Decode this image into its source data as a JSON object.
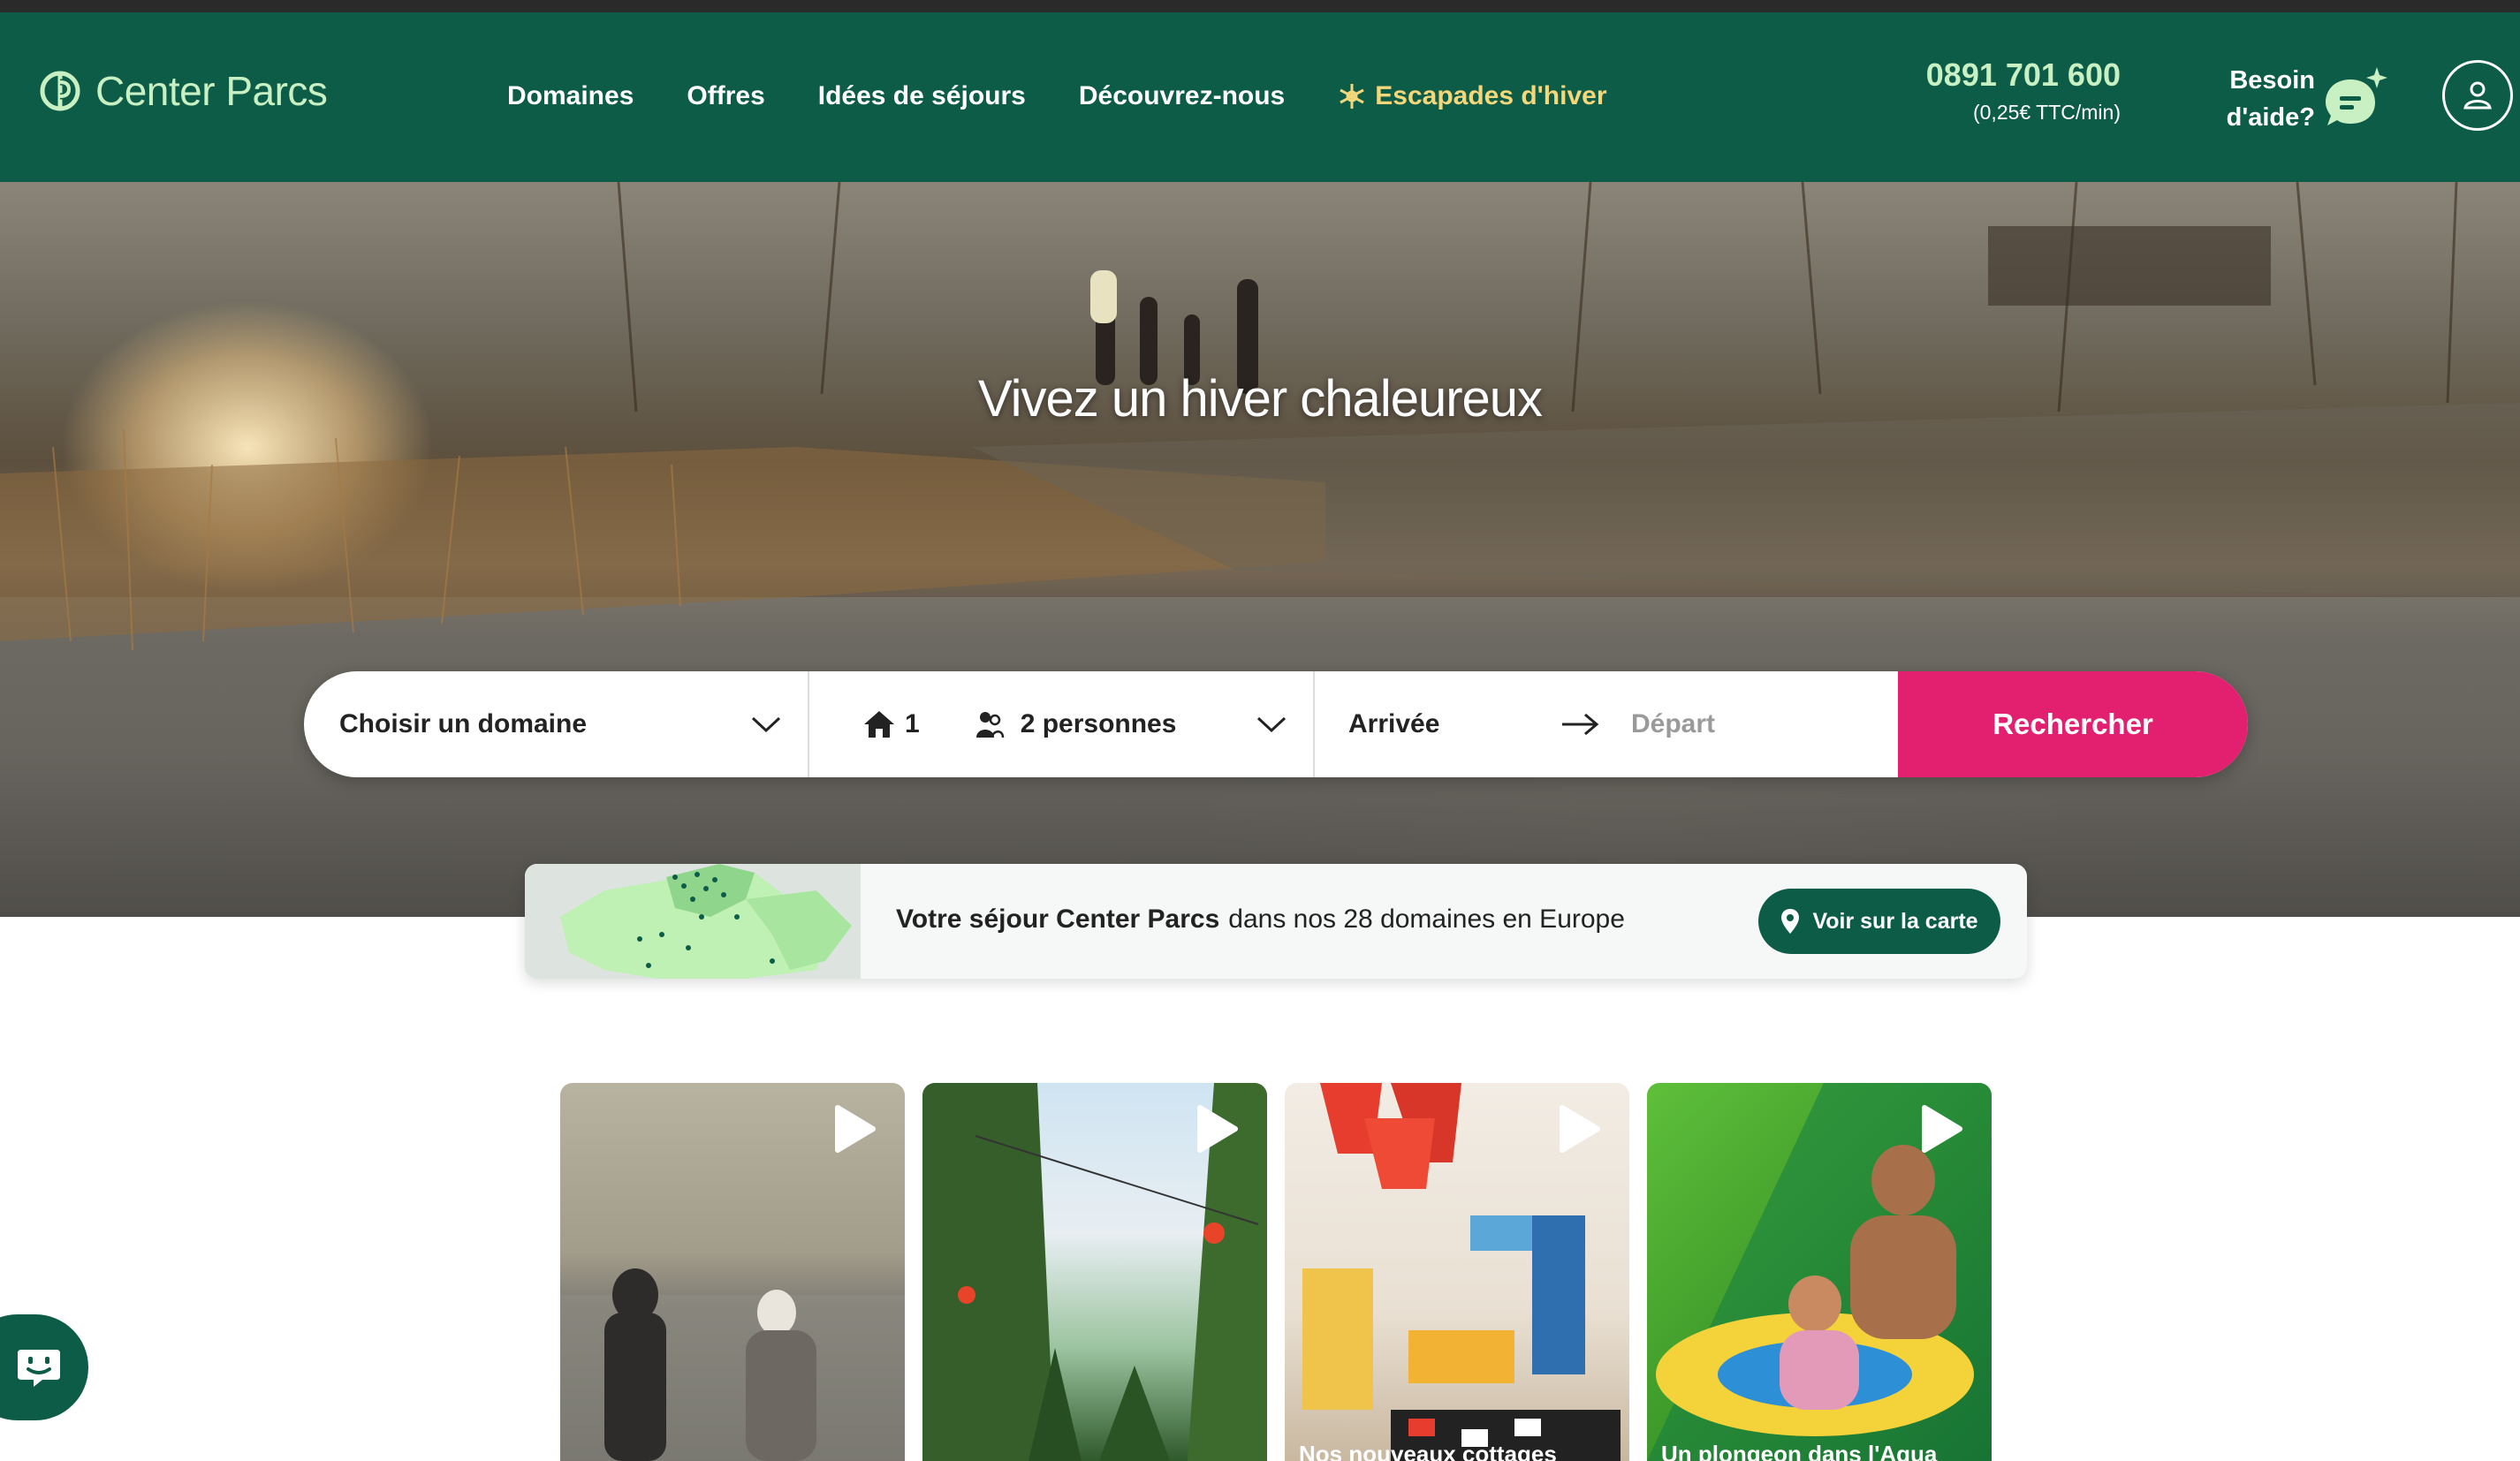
{
  "header": {
    "logo_text": "Center Parcs",
    "nav": {
      "domaines": "Domaines",
      "offres": "Offres",
      "idees": "Idées de séjours",
      "decouvrez": "Découvrez-nous",
      "escapades": "Escapades d'hiver"
    },
    "phone_number": "0891 701 600",
    "phone_rate": "(0,25€ TTC/min)",
    "help_line1": "Besoin",
    "help_line2": "d'aide?"
  },
  "hero": {
    "title": "Vivez un hiver chaleureux"
  },
  "search": {
    "domain_label": "Choisir un domaine",
    "houses_count": "1",
    "people_label": "2 personnes",
    "arrival_label": "Arrivée",
    "departure_placeholder": "Départ",
    "submit_label": "Rechercher"
  },
  "map_card": {
    "bold_text": "Votre séjour Center Parcs",
    "text": "dans nos 28 domaines en Europe",
    "button_label": "Voir sur la carte"
  },
  "videos": [
    {
      "caption": ""
    },
    {
      "caption": ""
    },
    {
      "caption": "Nos nouveaux cottages"
    },
    {
      "caption": "Un plongeon dans l'Aqua"
    }
  ],
  "colors": {
    "brand_green": "#0c5c48",
    "accent_pink": "#e2206f",
    "winter_yellow": "#f4d77a",
    "logo_mint": "#c9f0c2"
  }
}
